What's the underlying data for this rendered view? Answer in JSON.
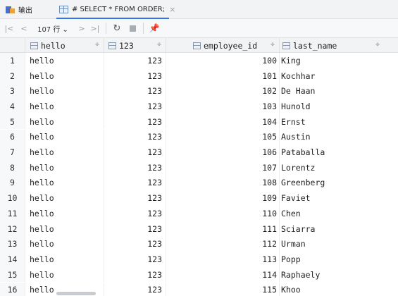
{
  "tabs": [
    {
      "label": "输出",
      "icon": "output-icon"
    },
    {
      "label": "# SELECT * FROM ORDER;",
      "icon": "table-icon",
      "close": "×"
    }
  ],
  "toolbar": {
    "first": "|<",
    "prev": "<",
    "row_count": "107 行 ⌄",
    "next": ">",
    "last": ">|",
    "refresh": "↻",
    "stop": "■",
    "pin": "📌"
  },
  "columns": [
    {
      "label": "hello",
      "sort": "÷"
    },
    {
      "label": "123",
      "sort": "÷"
    },
    {
      "label": "employee_id",
      "sort": "÷"
    },
    {
      "label": "last_name",
      "sort": "÷"
    }
  ],
  "rows": [
    {
      "n": "1",
      "hello": "hello",
      "num": "123",
      "employee_id": "100",
      "last_name": "King"
    },
    {
      "n": "2",
      "hello": "hello",
      "num": "123",
      "employee_id": "101",
      "last_name": "Kochhar"
    },
    {
      "n": "3",
      "hello": "hello",
      "num": "123",
      "employee_id": "102",
      "last_name": "De Haan"
    },
    {
      "n": "4",
      "hello": "hello",
      "num": "123",
      "employee_id": "103",
      "last_name": "Hunold"
    },
    {
      "n": "5",
      "hello": "hello",
      "num": "123",
      "employee_id": "104",
      "last_name": "Ernst"
    },
    {
      "n": "6",
      "hello": "hello",
      "num": "123",
      "employee_id": "105",
      "last_name": "Austin"
    },
    {
      "n": "7",
      "hello": "hello",
      "num": "123",
      "employee_id": "106",
      "last_name": "Pataballa"
    },
    {
      "n": "8",
      "hello": "hello",
      "num": "123",
      "employee_id": "107",
      "last_name": "Lorentz"
    },
    {
      "n": "9",
      "hello": "hello",
      "num": "123",
      "employee_id": "108",
      "last_name": "Greenberg"
    },
    {
      "n": "10",
      "hello": "hello",
      "num": "123",
      "employee_id": "109",
      "last_name": "Faviet"
    },
    {
      "n": "11",
      "hello": "hello",
      "num": "123",
      "employee_id": "110",
      "last_name": "Chen"
    },
    {
      "n": "12",
      "hello": "hello",
      "num": "123",
      "employee_id": "111",
      "last_name": "Sciarra"
    },
    {
      "n": "13",
      "hello": "hello",
      "num": "123",
      "employee_id": "112",
      "last_name": "Urman"
    },
    {
      "n": "14",
      "hello": "hello",
      "num": "123",
      "employee_id": "113",
      "last_name": "Popp"
    },
    {
      "n": "15",
      "hello": "hello",
      "num": "123",
      "employee_id": "114",
      "last_name": "Raphaely"
    },
    {
      "n": "16",
      "hello": "hello",
      "num": "123",
      "employee_id": "115",
      "last_name": "Khoo"
    }
  ]
}
